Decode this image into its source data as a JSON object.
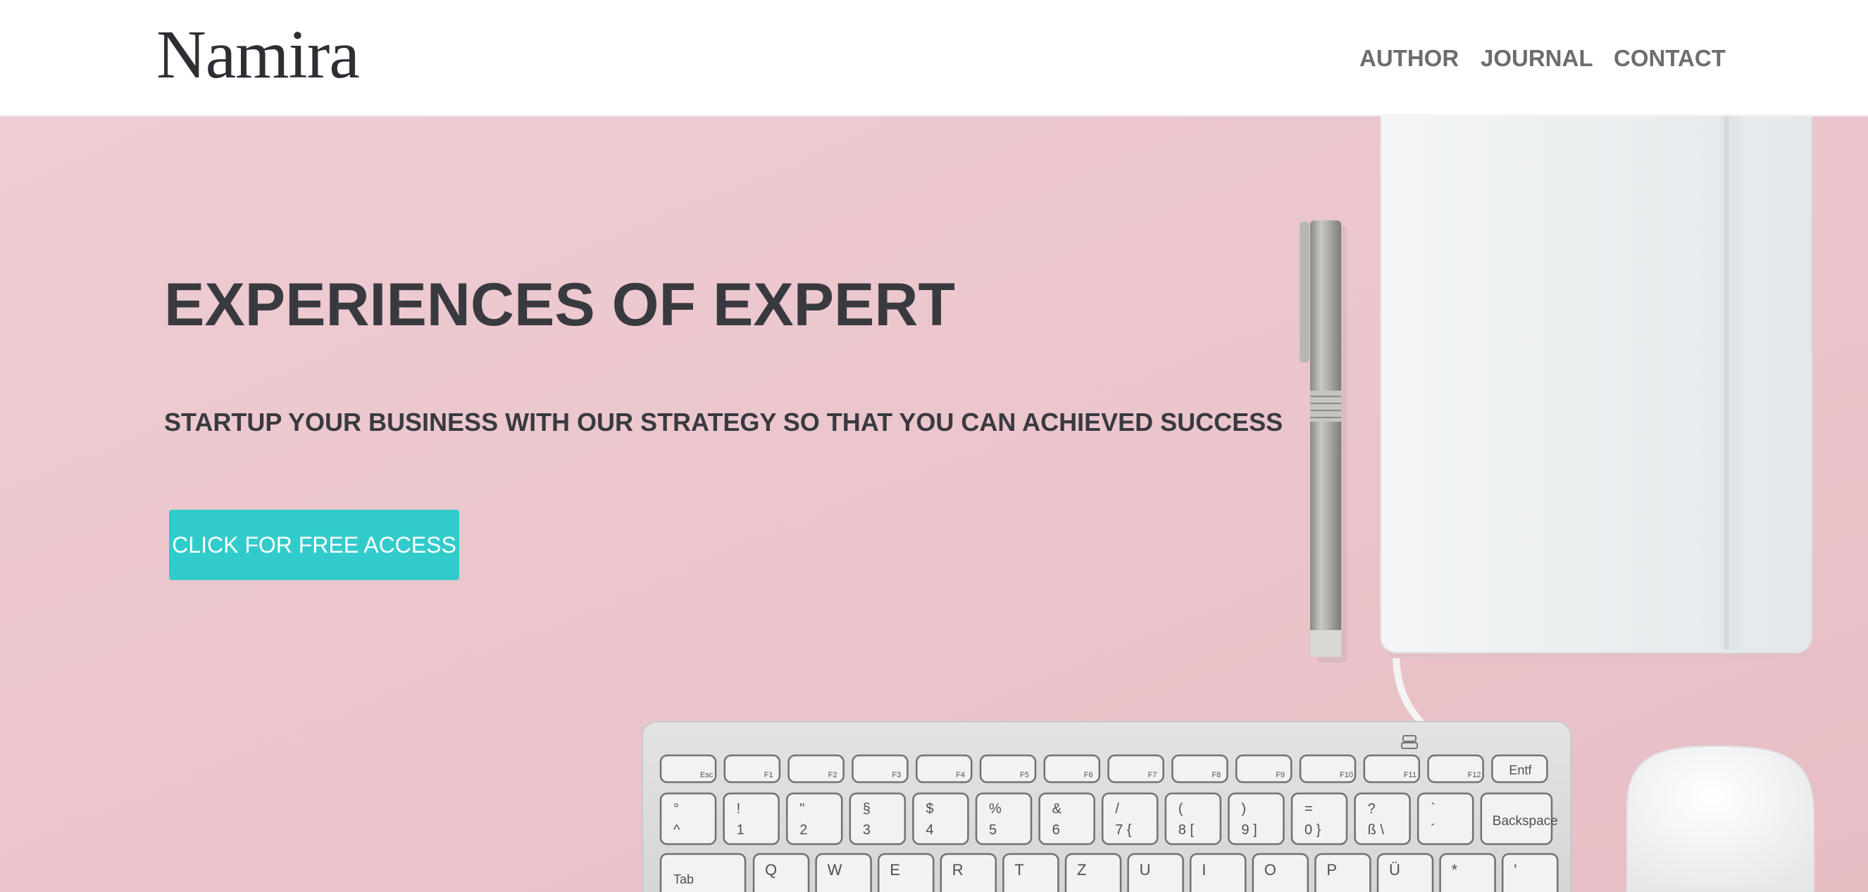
{
  "header": {
    "logo": "Namira",
    "nav": [
      "AUTHOR",
      "JOURNAL",
      "CONTACT"
    ]
  },
  "hero": {
    "title": "EXPERIENCES OF EXPERT",
    "subtitle": "STARTUP YOUR BUSINESS WITH OUR STRATEGY SO THAT YOU CAN ACHIEVED SUCCESS",
    "cta_label": "CLICK FOR FREE ACCESS",
    "image_subject": "pink desk with pen, notebook, keyboard and mouse"
  },
  "keyboard": {
    "function_row": [
      "Esc",
      "F1",
      "F2",
      "F3",
      "F4",
      "F5",
      "F6",
      "F7",
      "F8",
      "F9",
      "F10",
      "F11",
      "F12",
      "Entf"
    ],
    "number_row": [
      {
        "top": "°",
        "bottom": "^"
      },
      {
        "top": "!",
        "bottom": "1"
      },
      {
        "top": "\"",
        "bottom": "2"
      },
      {
        "top": "§",
        "bottom": "3"
      },
      {
        "top": "$",
        "bottom": "4"
      },
      {
        "top": "%",
        "bottom": "5"
      },
      {
        "top": "&",
        "bottom": "6"
      },
      {
        "top": "/",
        "bottom": "7 {"
      },
      {
        "top": "(",
        "bottom": "8 ["
      },
      {
        "top": ")",
        "bottom": "9 ]"
      },
      {
        "top": "=",
        "bottom": "0 }"
      },
      {
        "top": "?",
        "bottom": "ß \\"
      },
      {
        "top": "`",
        "bottom": "´"
      }
    ],
    "backspace": "Backspace",
    "tab": "Tab",
    "letter_row": [
      "Q",
      "W",
      "E",
      "R",
      "T",
      "Z",
      "U",
      "I",
      "O",
      "P",
      "Ü",
      "*",
      "'"
    ]
  },
  "colors": {
    "hero_background": "#ecc9cf",
    "cta_background": "#32cbcb",
    "heading_text": "#393a40",
    "nav_text": "#6b6d70"
  }
}
